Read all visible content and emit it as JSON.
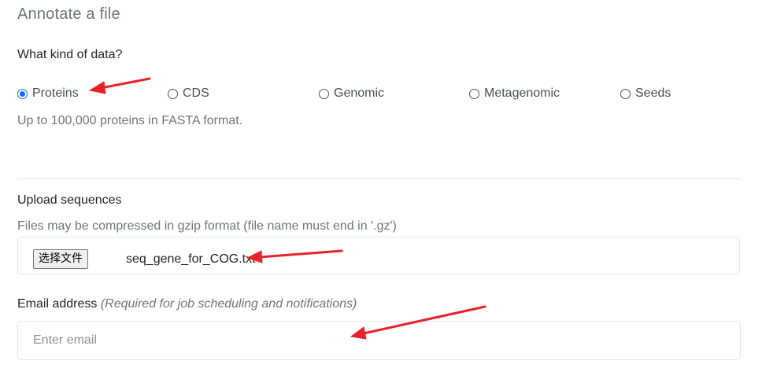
{
  "form": {
    "title": "Annotate a file",
    "data_question": "What kind of data?",
    "data_types": [
      {
        "label": "Proteins",
        "checked": true
      },
      {
        "label": "CDS",
        "checked": false
      },
      {
        "label": "Genomic",
        "checked": false
      },
      {
        "label": "Metagenomic",
        "checked": false
      },
      {
        "label": "Seeds",
        "checked": false
      }
    ],
    "data_type_help": "Up to 100,000 proteins in FASTA format.",
    "upload": {
      "label": "Upload sequences",
      "help": "Files may be compressed in gzip format (file name must end in '.gz')",
      "button_label": "选择文件",
      "file_name": "seq_gene_for_COG.txt"
    },
    "email": {
      "label": "Email address",
      "hint": "(Required for job scheduling and notifications)",
      "placeholder": "Enter email",
      "value": ""
    }
  },
  "colors": {
    "accent": "#0d6efd",
    "annotation_arrow": "#e8222a",
    "muted_text": "#6c757d",
    "border": "#e4e7ea"
  }
}
